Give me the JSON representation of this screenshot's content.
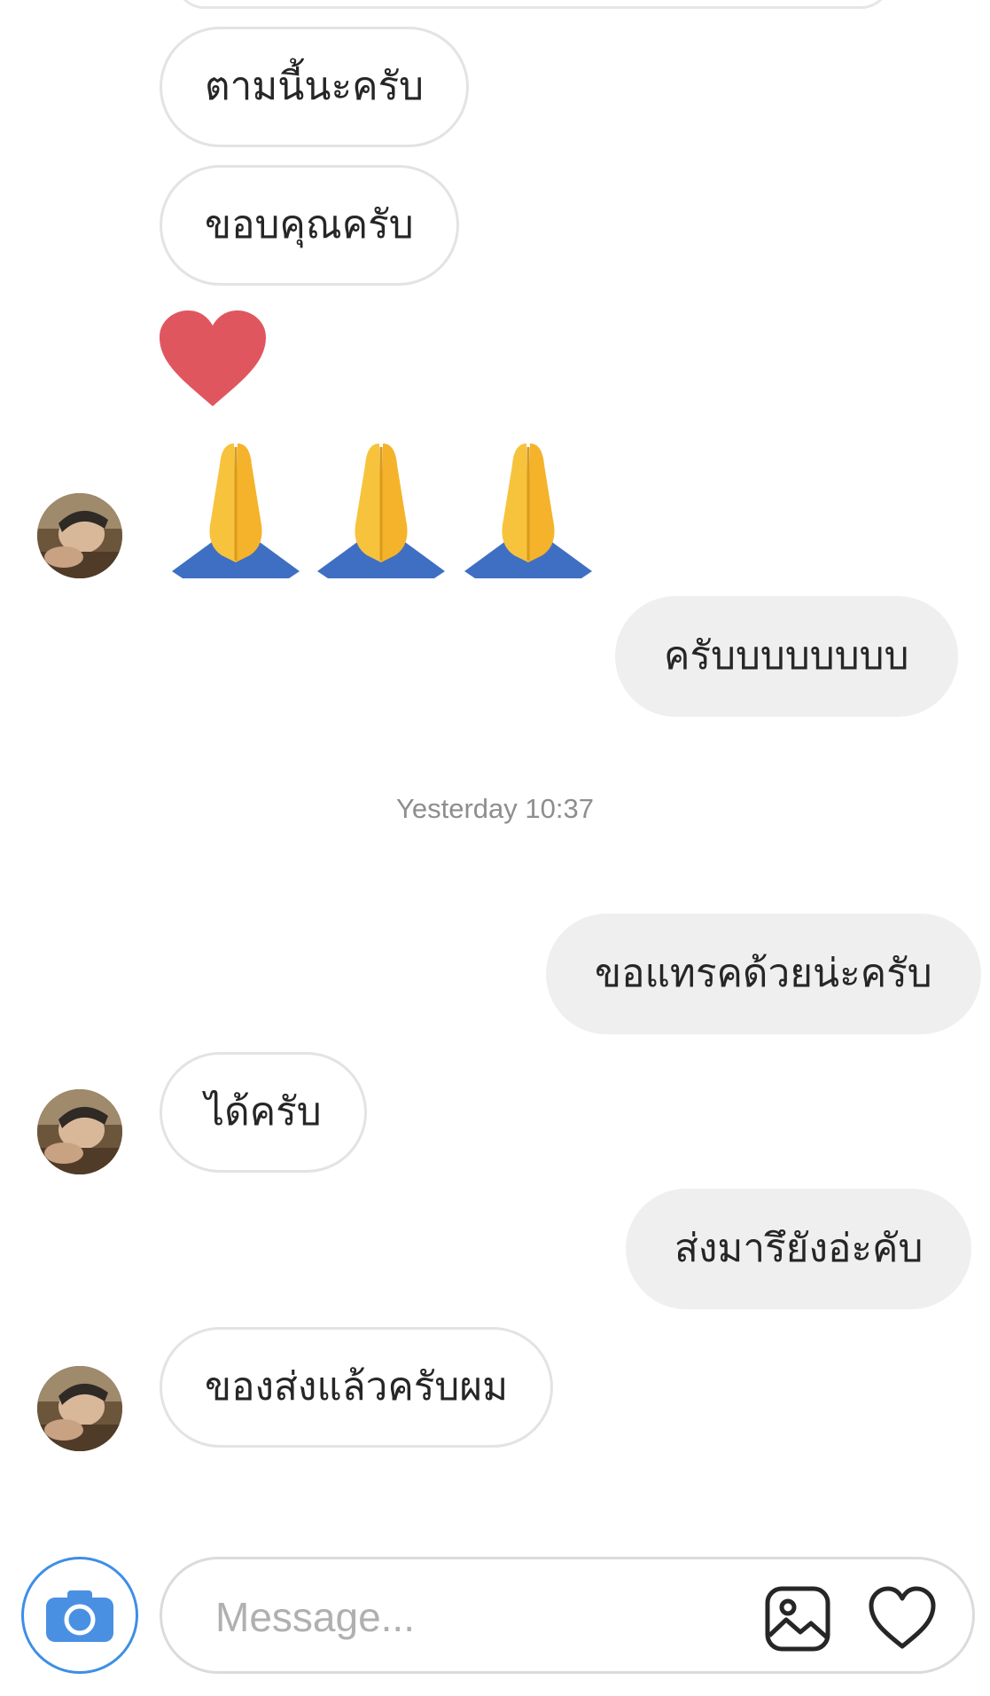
{
  "messages": {
    "m1": "ตามนี้นะครับ",
    "m2": "ขอบคุณครับ",
    "m3": "ครับบบบบบบบ",
    "m4": "ขอแทรคด้วยน่ะครับ",
    "m5": "ได้ครับ",
    "m6": "ส่งมารึยังอ่ะคับ",
    "m7": "ของส่งแล้วครับผม"
  },
  "timestamp": "Yesterday 10:37",
  "composer": {
    "placeholder": "Message..."
  },
  "colors": {
    "accent": "#3e8ee6",
    "outgoing_bubble": "#efefef",
    "incoming_border": "#e3e3e3",
    "heart": "#e0565f"
  },
  "icons": [
    "heart-emoji-icon",
    "folded-hands-emoji-icon",
    "camera-icon",
    "gallery-icon",
    "heart-icon"
  ]
}
